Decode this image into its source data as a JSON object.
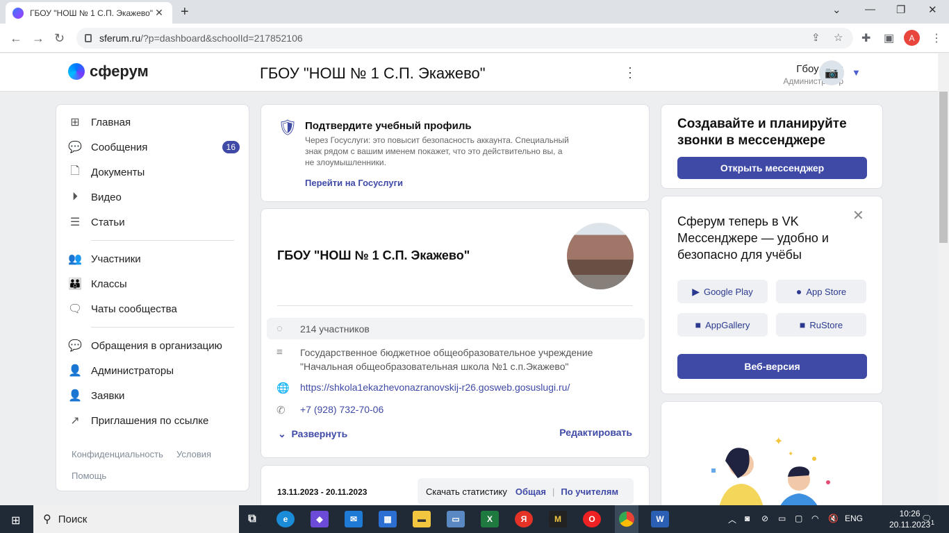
{
  "browser": {
    "tab_title": "ГБОУ \"НОШ № 1 С.П. Экажево\"",
    "url_domain": "sferum.ru",
    "url_path": "/?p=dashboard&schoolId=217852106",
    "profile_initial": "A"
  },
  "header": {
    "logo_text": "сферум",
    "school_title": "ГБОУ \"НОШ № 1 С.П. Экажево\"",
    "user_name": "Гбоу Нош",
    "user_role": "Администратор"
  },
  "sidebar": {
    "items": [
      {
        "label": "Главная",
        "icon": "grid-icon"
      },
      {
        "label": "Сообщения",
        "icon": "chat-bubble-icon",
        "badge": "16"
      },
      {
        "label": "Документы",
        "icon": "document-icon"
      },
      {
        "label": "Видео",
        "icon": "play-icon"
      },
      {
        "label": "Статьи",
        "icon": "article-icon"
      },
      {
        "label": "Участники",
        "icon": "users-icon"
      },
      {
        "label": "Классы",
        "icon": "group-icon"
      },
      {
        "label": "Чаты сообщества",
        "icon": "chats-icon"
      },
      {
        "label": "Обращения в организацию",
        "icon": "chat-bubble-icon"
      },
      {
        "label": "Администраторы",
        "icon": "person-icon"
      },
      {
        "label": "Заявки",
        "icon": "person-add-icon"
      },
      {
        "label": "Приглашения по ссылке",
        "icon": "link-arrow-icon"
      }
    ],
    "footer_privacy": "Конфиденциальность",
    "footer_terms": "Условия",
    "footer_help": "Помощь"
  },
  "verify": {
    "title": "Подтвердите учебный профиль",
    "text": "Через Госуслуги: это повысит безопасность аккаунта. Специальный знак рядом с вашим именем покажет, что это действительно вы, а не злоумышленники.",
    "link": "Перейти на Госуслуги"
  },
  "school": {
    "name": "ГБОУ \"НОШ № 1 С.П. Экажево\"",
    "members": "214 участников",
    "full_name": "Государственное бюджетное общеобразовательное учреждение \"Начальная общеобразовательная школа №1 с.п.Экажево\"",
    "website": "https://shkola1ekazhevonazranovskij-r26.gosweb.gosuslugi.ru/",
    "phone": "+7 (928) 732-70-06",
    "expand": "Развернуть",
    "edit": "Редактировать"
  },
  "stats": {
    "dates": "13.11.2023 - 20.11.2023",
    "download": "Скачать статистику",
    "general": "Общая",
    "sep": "|",
    "by_teachers": "По учителям"
  },
  "promo1": {
    "title": "Создавайте и планируйте звонки в мессенджере",
    "button": "Открыть мессенджер"
  },
  "promo2": {
    "text": "Сферум теперь в VK Мессенджере — удобно и безопасно для учёбы",
    "stores": [
      "Google Play",
      "App Store",
      "AppGallery",
      "RuStore"
    ],
    "web_button": "Веб-версия"
  },
  "taskbar": {
    "search": "Поиск",
    "lang": "ENG",
    "time": "10:26",
    "date": "20.11.2023",
    "notif_count": "1"
  },
  "colors": {
    "accent": "#3f4aa7",
    "badge": "#3f4aa7",
    "taskbar": "#1f2a36"
  }
}
